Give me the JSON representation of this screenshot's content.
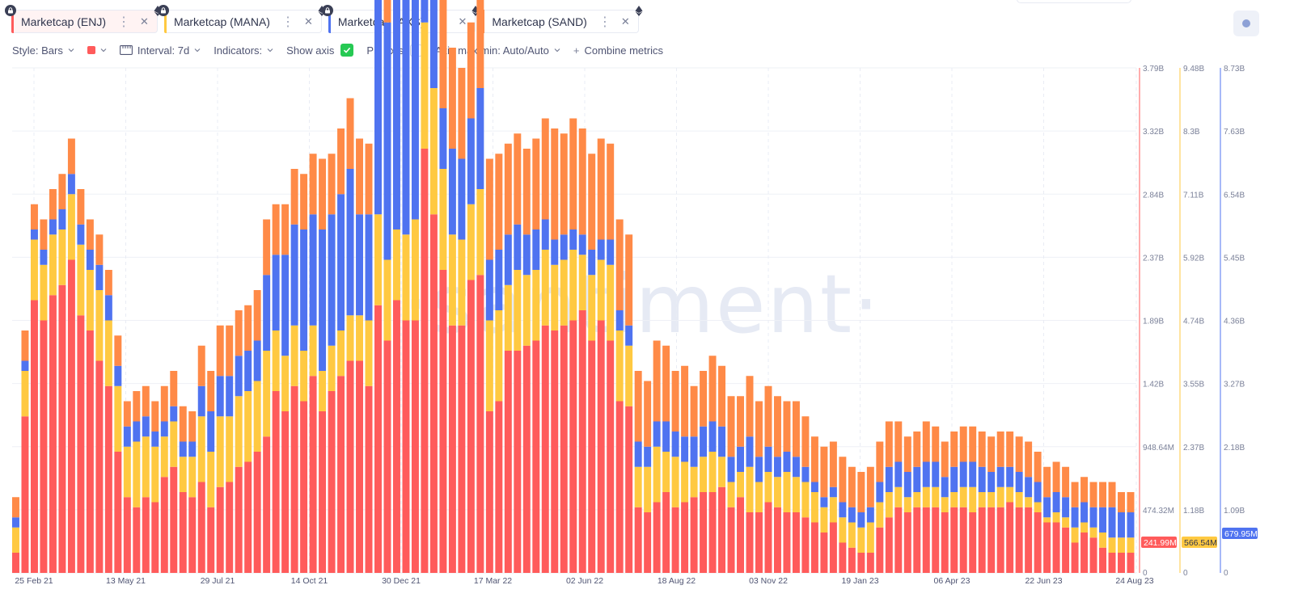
{
  "tabs": [
    {
      "label": "Marketcap (ENJ)",
      "color": "#ff5b5b"
    },
    {
      "label": "Marketcap (MANA)",
      "color": "#ffc941"
    },
    {
      "label": "Marketcap (AXS)",
      "color": "#4f73f0"
    },
    {
      "label": "Marketcap (SAND)",
      "color": "#ff8a47"
    }
  ],
  "toolbar": {
    "style_label": "Style: Bars",
    "interval_label": "Interval: 7d",
    "indicators_label": "Indicators:",
    "show_axis_label": "Show axis",
    "pin_axis_label": "Pin axis",
    "axis_minmax_label": "Axis max/min: Auto/Auto",
    "combine_label": "Combine metrics"
  },
  "watermark": "·santiment·",
  "chart_data": {
    "type": "bar",
    "stacked": true,
    "x_ticks": [
      "25 Feb 21",
      "13 May 21",
      "29 Jul 21",
      "14 Oct 21",
      "30 Dec 21",
      "17 Mar 22",
      "02 Jun 22",
      "18 Aug 22",
      "03 Nov 22",
      "19 Jan 23",
      "06 Apr 23",
      "22 Jun 23",
      "24 Aug 23"
    ],
    "axes": [
      {
        "series": "ENJ",
        "color": "#ff5b5b",
        "ticks": [
          "0",
          "474.32M",
          "948.64M",
          "1.42B",
          "1.89B",
          "2.37B",
          "2.84B",
          "3.32B",
          "3.79B"
        ],
        "last_value": "241.99M"
      },
      {
        "series": "MANA",
        "color": "#ffc941",
        "ticks": [
          "0",
          "1.18B",
          "2.37B",
          "3.55B",
          "4.74B",
          "5.92B",
          "7.11B",
          "8.3B",
          "9.48B"
        ],
        "last_value": "566.54M"
      },
      {
        "series": "AXS",
        "color": "#4f73f0",
        "ticks": [
          "0",
          "1.09B",
          "2.18B",
          "3.27B",
          "4.36B",
          "5.45B",
          "6.54B",
          "7.63B",
          "8.73B"
        ],
        "last_value": "679.95M"
      }
    ],
    "series_colors": {
      "ENJ": "#ff5b5b",
      "MANA": "#ffc941",
      "AXS": "#4f73f0",
      "SAND": "#ff8a47"
    },
    "bars_percent_of_axis_max": {
      "ENJ": [
        4,
        31,
        54,
        50,
        55,
        57,
        62,
        51,
        48,
        42,
        37,
        24,
        15,
        13,
        15,
        14,
        19,
        21,
        16,
        15,
        18,
        13,
        17,
        18,
        21,
        22,
        24,
        27,
        36,
        32,
        37,
        34,
        39,
        32,
        36,
        39,
        42,
        42,
        37,
        53,
        46,
        54,
        50,
        50,
        84,
        71,
        60,
        49,
        49,
        58,
        59,
        32,
        34,
        44,
        44,
        45,
        46,
        49,
        48,
        49,
        50,
        52,
        46,
        50,
        46,
        34,
        33,
        13,
        12,
        14,
        16,
        13,
        14,
        15,
        16,
        16,
        17,
        13,
        15,
        12,
        12,
        14,
        13,
        12,
        12,
        11,
        10,
        8,
        10,
        6,
        5,
        4,
        4,
        9,
        11,
        13,
        12,
        13,
        13,
        13,
        12,
        13,
        13,
        12,
        13,
        13,
        13,
        14,
        13,
        13,
        12,
        10,
        10,
        9,
        6,
        8,
        7,
        5,
        4,
        4,
        4
      ],
      "MANA": [
        5,
        9,
        12,
        11,
        12,
        11,
        13,
        14,
        12,
        14,
        13,
        13,
        10,
        13,
        12,
        11,
        8,
        9,
        7,
        8,
        13,
        11,
        14,
        13,
        14,
        14,
        14,
        17,
        12,
        11,
        12,
        10,
        10,
        8,
        9,
        9,
        9,
        9,
        13,
        18,
        16,
        14,
        17,
        20,
        25,
        25,
        20,
        18,
        17,
        15,
        17,
        18,
        18,
        13,
        16,
        14,
        14,
        15,
        13,
        13,
        14,
        11,
        13,
        12,
        15,
        14,
        12,
        8,
        9,
        11,
        8,
        10,
        8,
        6,
        7,
        8,
        6,
        5,
        5,
        9,
        6,
        6,
        6,
        8,
        7,
        7,
        6,
        5,
        5,
        5,
        5,
        5,
        6,
        5,
        5,
        4,
        3,
        3,
        4,
        4,
        3,
        3,
        4,
        5,
        3,
        3,
        4,
        3,
        3,
        2,
        2,
        1,
        2,
        2,
        3,
        2,
        2,
        3,
        3,
        3,
        3
      ],
      "AXS": [
        2,
        2,
        2,
        3,
        3,
        4,
        4,
        4,
        4,
        5,
        5,
        4,
        4,
        4,
        4,
        3,
        3,
        3,
        3,
        3,
        6,
        8,
        8,
        8,
        8,
        8,
        8,
        15,
        15,
        20,
        20,
        24,
        22,
        28,
        26,
        27,
        29,
        20,
        21,
        53,
        47,
        49,
        52,
        54,
        27,
        28,
        12,
        17,
        16,
        17,
        20,
        12,
        12,
        10,
        9,
        8,
        8,
        6,
        5,
        5,
        4,
        4,
        5,
        4,
        5,
        4,
        4,
        5,
        4,
        5,
        6,
        5,
        5,
        6,
        6,
        6,
        6,
        5,
        5,
        6,
        5,
        5,
        4,
        4,
        4,
        3,
        2,
        2,
        2,
        3,
        3,
        3,
        3,
        4,
        5,
        5,
        5,
        5,
        5,
        5,
        4,
        5,
        5,
        5,
        5,
        4,
        4,
        4,
        4,
        4,
        4,
        4,
        4,
        4,
        4,
        4,
        4,
        5,
        6,
        5,
        5
      ],
      "SAND": [
        4,
        6,
        5,
        6,
        6,
        7,
        7,
        7,
        6,
        6,
        5,
        6,
        5,
        6,
        6,
        6,
        7,
        7,
        7,
        6,
        8,
        8,
        10,
        10,
        9,
        9,
        10,
        11,
        10,
        10,
        11,
        11,
        12,
        14,
        12,
        13,
        14,
        15,
        14,
        18,
        15,
        15,
        16,
        17,
        21,
        25,
        24,
        20,
        18,
        19,
        20,
        20,
        19,
        18,
        18,
        17,
        18,
        20,
        22,
        20,
        22,
        21,
        19,
        20,
        19,
        18,
        18,
        14,
        13,
        16,
        15,
        12,
        14,
        10,
        11,
        13,
        12,
        12,
        10,
        12,
        11,
        12,
        12,
        10,
        11,
        10,
        9,
        10,
        9,
        9,
        8,
        8,
        8,
        8,
        9,
        8,
        7,
        7,
        8,
        7,
        7,
        7,
        7,
        7,
        7,
        7,
        7,
        7,
        7,
        7,
        6,
        6,
        6,
        6,
        5,
        5,
        5,
        5,
        5,
        4,
        4
      ]
    }
  }
}
